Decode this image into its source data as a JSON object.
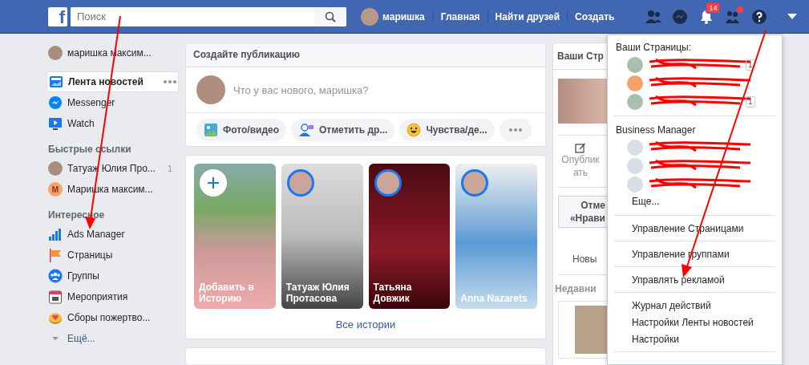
{
  "topbar": {
    "logo": "f",
    "search": {
      "placeholder": "Поиск"
    },
    "profile_name": "маришка",
    "nav": [
      "Главная",
      "Найти друзей",
      "Создать"
    ],
    "notifications_badge": "14",
    "requests_dot": true
  },
  "sidebar": {
    "profile": "маришка максим...",
    "main": [
      {
        "label": "Лента новостей",
        "kind": "news",
        "selected": true
      },
      {
        "label": "Messenger",
        "kind": "messenger",
        "selected": false
      },
      {
        "label": "Watch",
        "kind": "watch",
        "selected": false
      }
    ],
    "shortcuts_title": "Быстрые ссылки",
    "shortcuts": [
      {
        "label": "Татуаж Юлия Про...",
        "kind": "photo",
        "count": "1"
      },
      {
        "label": "Маришка максим...",
        "kind": "letter",
        "letter": "М"
      }
    ],
    "explore_title": "Интересное",
    "explore": [
      {
        "label": "Ads Manager",
        "kind": "ads"
      },
      {
        "label": "Страницы",
        "kind": "pages"
      },
      {
        "label": "Группы",
        "kind": "groups"
      },
      {
        "label": "Мероприятия",
        "kind": "events"
      },
      {
        "label": "Сборы пожертво...",
        "kind": "fundraisers"
      }
    ],
    "more": "Ещё..."
  },
  "composer": {
    "title": "Создайте публикацию",
    "placeholder": "Что у вас нового, маришка?",
    "actions": [
      {
        "label": "Фото/видео",
        "kind": "photo"
      },
      {
        "label": "Отметить др...",
        "kind": "tag"
      },
      {
        "label": "Чувства/де...",
        "kind": "feeling"
      },
      {
        "kind": "more"
      }
    ]
  },
  "stories": {
    "items": [
      {
        "name": "Добавить в Историю",
        "kind": "add"
      },
      {
        "name": "Татуаж Юлия Протасова",
        "kind": "friend"
      },
      {
        "name": "Татьяна Довжик",
        "kind": "friend"
      },
      {
        "name": "Anna Nazarets",
        "kind": "friend"
      }
    ],
    "link": "Все истории"
  },
  "right_column": {
    "title": "Ваши Стр",
    "publish": [
      "Опублик",
      "ать"
    ],
    "like_button": [
      "Отме",
      "«Нрави"
    ],
    "new": "Новы",
    "recent_title": "Недавни"
  },
  "menu": {
    "pages_title": "Ваши Страницы:",
    "pages": [
      {
        "kind": "photo",
        "badge": "1"
      },
      {
        "kind": "letter"
      },
      {
        "kind": "photo",
        "badge": "1"
      }
    ],
    "business_title": "Business Manager",
    "business": [
      {
        "kind": "generic"
      },
      {
        "kind": "generic"
      },
      {
        "kind": "generic"
      }
    ],
    "more": "Еще...",
    "groups": [
      [
        "Управление Страницами"
      ],
      [
        "Управление группами"
      ],
      [
        "Управлять рекламой"
      ],
      [
        "Журнал действий",
        "Настройки Ленты новостей",
        "Настройки"
      ]
    ]
  }
}
